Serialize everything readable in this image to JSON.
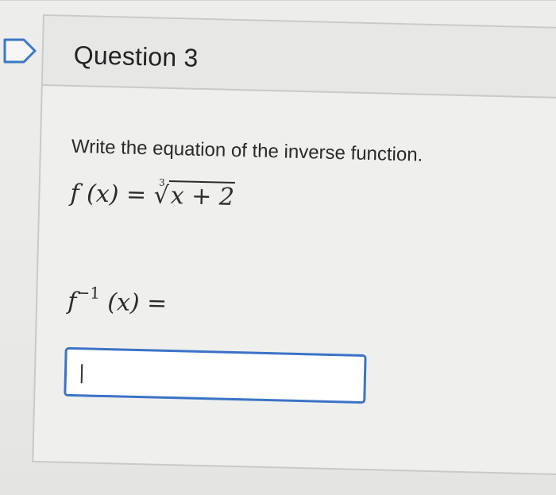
{
  "question": {
    "title": "Question 3",
    "prompt": "Write the equation of the inverse function.",
    "function_lhs": "f (x) = ",
    "root_index": "3",
    "radicand": "x + 2",
    "inverse_f": "f",
    "inverse_exponent": "−1",
    "inverse_rest": " (x) =",
    "answer_value": ""
  }
}
